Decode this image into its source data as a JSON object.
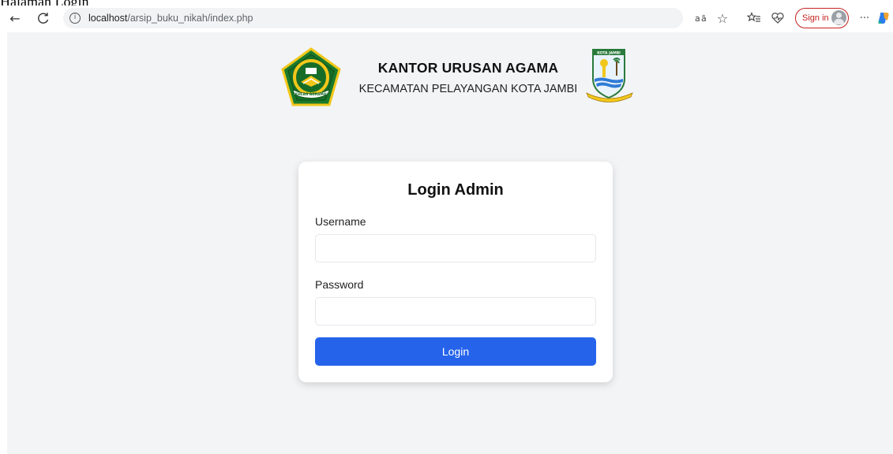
{
  "caption": "Halaman Login",
  "browser": {
    "url_host": "localhost",
    "url_path": "/arsip_buku_nikah/index.php",
    "back_icon": "←",
    "refresh_icon": "C",
    "info_icon": "i",
    "read_aloud_icon": "a⁘",
    "favorite_icon": "☆",
    "favorites_list_icon": "≤",
    "health_icon": "♡",
    "sign_in_label": "Sign in",
    "more_icon": "···",
    "accent_color": "#c5221f"
  },
  "header": {
    "title": "KANTOR URUSAN AGAMA",
    "subtitle": "KECAMATAN PELAYANGAN KOTA JAMBI",
    "kemenag_logo_text": "IKHLAS BERAMAL",
    "jambi_logo_text": "KOTA JAMBI"
  },
  "login": {
    "title": "Login Admin",
    "username_label": "Username",
    "username_value": "",
    "password_label": "Password",
    "password_value": "",
    "button_label": "Login",
    "button_color": "#2563eb"
  }
}
